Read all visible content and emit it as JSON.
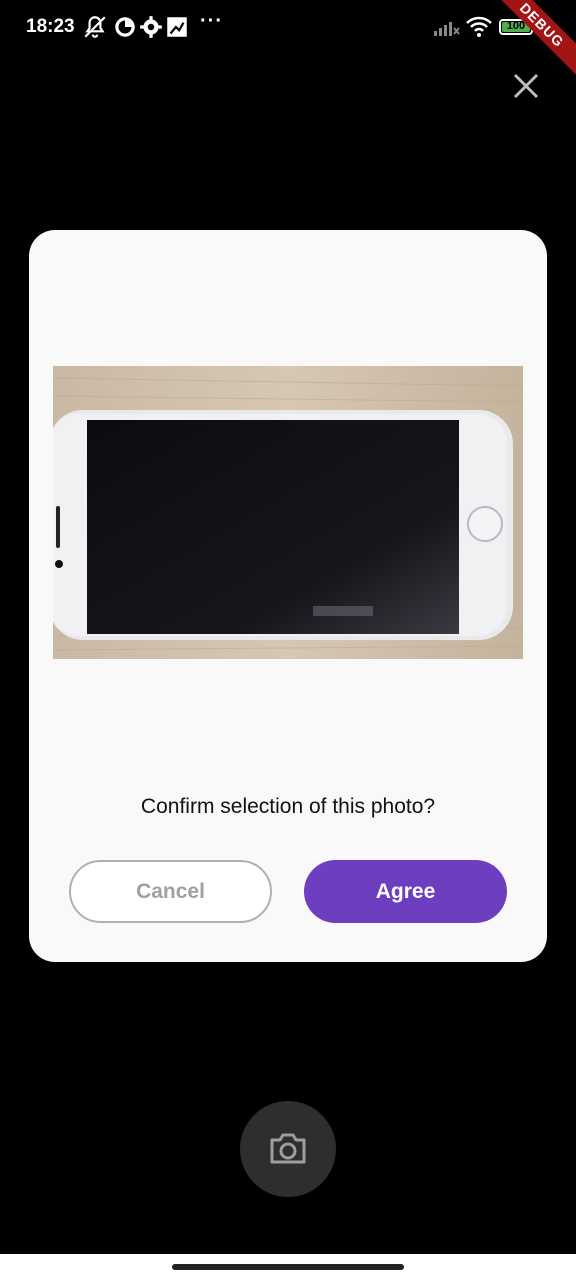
{
  "status_bar": {
    "time": "18:23",
    "more": "···",
    "battery_level": "100",
    "debug_label": "DEBUG",
    "icons": [
      "mute-icon",
      "record-icon",
      "settings-icon",
      "cast-icon",
      "signal-icon",
      "wifi-icon",
      "battery-icon",
      "charging-icon"
    ]
  },
  "dialog": {
    "question": "Confirm selection of this photo?",
    "cancel_label": "Cancel",
    "agree_label": "Agree"
  },
  "colors": {
    "accent": "#6d3fc0",
    "dialog_bg": "#f9f9f9",
    "background": "#000000",
    "debug_ribbon": "#a31515"
  }
}
